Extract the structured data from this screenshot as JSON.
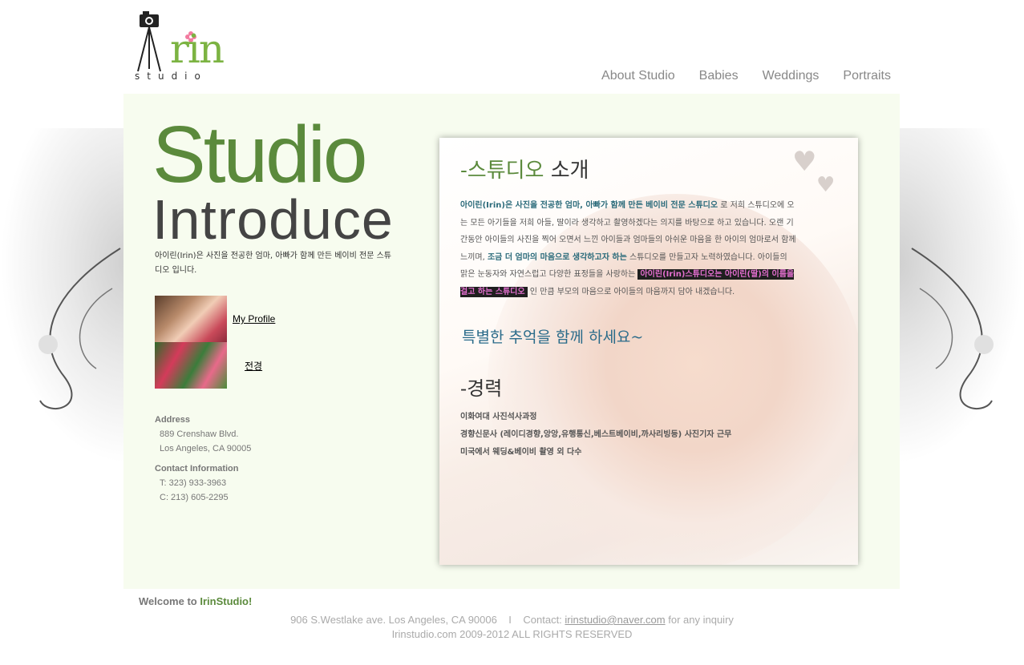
{
  "logo": {
    "text": "rin",
    "subtext": "studio"
  },
  "nav": [
    "About Studio",
    "Babies",
    "Weddings",
    "Portraits"
  ],
  "hero": {
    "title_line1": "Studio",
    "title_line2": "Introduce",
    "intro_text": "아이린(Irin)은 사진을 전공한 엄마, 아빠가 함께 만든 베이비 전문 스튜디오 입니다."
  },
  "thumbs": [
    {
      "label": "My Profile"
    },
    {
      "label": "전경"
    }
  ],
  "contact": {
    "address_heading": "Address",
    "address_line1": "889 Crenshaw Blvd.",
    "address_line2": "Los Angeles, CA 90005",
    "info_heading": "Contact Information",
    "phone": "T: 323) 933-3963",
    "cell": "C: 213) 605-2295"
  },
  "card": {
    "heading_intro_prefix": "-스튜디오",
    "heading_intro_suffix": "소개",
    "p1_bold": "아이린(Irin)은 사진을 전공한 엄마, 아빠가 함께 만든 베이비 전문 스튜디오",
    "p1_rest": "로 저희 스튜디오에 오는 모든 아기들을 저희 아들, 딸이라 생각하고 촬영하겠다는 의지를 바탕으로 하고 있습니다. 오랜 기간동안 아이들의 사진을 찍어 오면서 느낀 아이들과 엄마들의 아쉬운 마음을 한 아이의 엄마로서 함께 느끼며,",
    "p1_bold2": "조금 더 엄마의 마음으로 생각하고자 하는",
    "p1_rest2": "스튜디오를 만들고자 노력하였습니다. 아이들의 맑은 눈동자와 자연스럽고 다양한 표정들을 사랑하는",
    "highlight": "아이린(Irin)스튜디오는 아이린(딸)의 이름을 걸고 하는 스튜디오",
    "p1_rest3": "인 만큼 부모의 마음으로 아이들의 마음까지 담아 내겠습니다.",
    "memory": "특별한 추억을 함께 하세요~",
    "heading_career": "-경력",
    "career": [
      "이화여대 사진석사과정",
      "경향신문사 (레이디경향,앙앙,유행통신,베스트베이비,까사리빙등) 사진기자 근무",
      "미국에서 웨딩&베이비 촬영 외 다수"
    ]
  },
  "welcome": {
    "prefix": "Welcome to",
    "brand": "IrinStudio!"
  },
  "footer": {
    "address": "906 S.Westlake ave. Los Angeles, CA 90006",
    "separator": "I",
    "contact_prefix": "Contact:",
    "email": "irinstudio@naver.com",
    "contact_suffix": "for any inquiry",
    "copyright": "Irinstudio.com 2009-2012 ALL RIGHTS RESERVED"
  },
  "colors": {
    "green": "#5b8a3c",
    "panel": "#f7fcef",
    "highlight": "#e36fcf"
  }
}
